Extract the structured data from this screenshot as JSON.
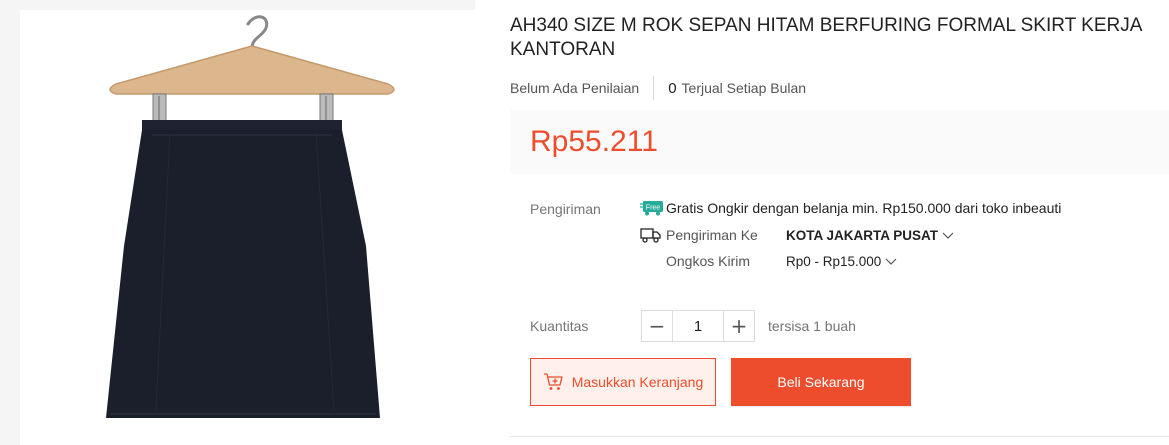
{
  "product": {
    "title": "AH340 SIZE M ROK SEPAN HITAM BERFURING FORMAL SKIRT KERJA KANTORAN",
    "image_alt": "Black pencil skirt on a wooden hanger"
  },
  "rating": {
    "no_rating_text": "Belum Ada Penilaian",
    "sold_count": "0",
    "sold_label": "Terjual Setiap Bulan"
  },
  "price": {
    "value": "Rp55.211"
  },
  "shipping": {
    "label": "Pengiriman",
    "free_badge": "Free",
    "free_text": "Gratis Ongkir dengan belanja min. Rp150.000 dari toko inbeauti",
    "to_label": "Pengiriman Ke",
    "to_value": "KOTA JAKARTA PUSAT",
    "cost_label": "Ongkos Kirim",
    "cost_value": "Rp0 - Rp15.000"
  },
  "quantity": {
    "label": "Kuantitas",
    "value": "1",
    "decrement": "−",
    "increment": "+",
    "stock_text": "tersisa 1 buah"
  },
  "actions": {
    "add_to_cart": "Masukkan Keranjang",
    "buy_now": "Beli Sekarang"
  },
  "colors": {
    "accent": "#ee4d2d",
    "free_badge": "#26aa99"
  }
}
